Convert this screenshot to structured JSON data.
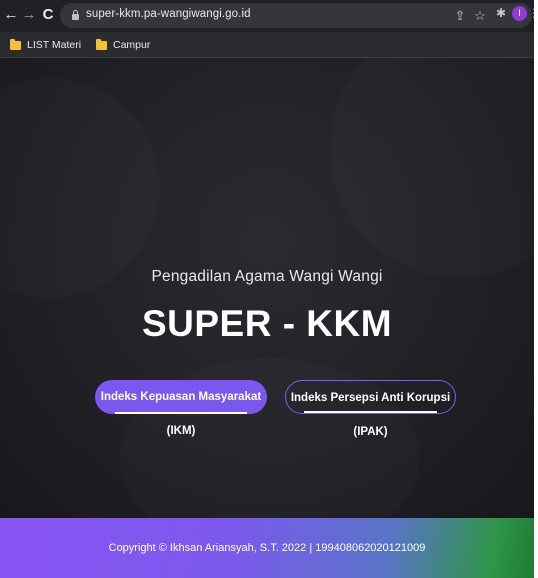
{
  "browser": {
    "url": "super-kkm.pa-wangiwangi.go.id",
    "profile_initial": "I",
    "bookmarks": [
      {
        "label": "LIST Materi"
      },
      {
        "label": "Campur"
      }
    ]
  },
  "hero": {
    "subtitle": "Pengadilan Agama Wangi Wangi",
    "title": "SUPER - KKM",
    "primary_button": "Indeks Kepuasan Masyarakat (IKM)",
    "secondary_button": "Indeks Persepsi Anti Korupsi (IPAK)"
  },
  "footer": {
    "copyright": "Copyright © Ikhsan Ariansyah, S.T. 2022 | 199408062020121009"
  },
  "colors": {
    "accent": "#7a58f0",
    "footer_start": "#8a55f3",
    "footer_end": "#1e7c35",
    "page_bg": "#1f1f24"
  },
  "icons": [
    "back-arrow-icon",
    "forward-arrow-icon",
    "reload-icon",
    "lock-icon",
    "share-icon",
    "star-icon",
    "extensions-icon",
    "sidepanel-icon",
    "menu-dots-icon",
    "folder-icon"
  ]
}
